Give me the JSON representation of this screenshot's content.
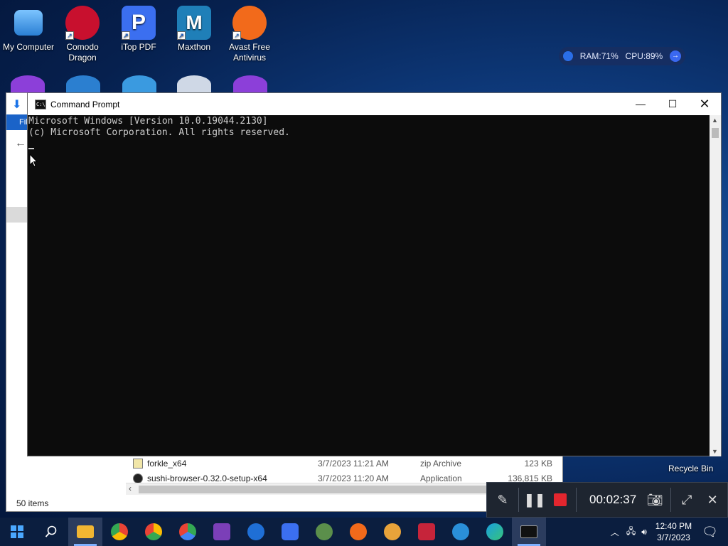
{
  "desktop": {
    "icons": [
      {
        "label": "My Computer",
        "color": "#2a7fd4"
      },
      {
        "label": "Comodo Dragon",
        "color": "#c8102e"
      },
      {
        "label": "iTop PDF",
        "color": "#3b6ff0"
      },
      {
        "label": "Maxthon",
        "color": "#1f7fb8"
      },
      {
        "label": "Avast Free Antivirus",
        "color": "#f26a1b"
      }
    ],
    "recycle_bin": "Recycle Bin"
  },
  "perf_widget": {
    "ram": "RAM:71%",
    "cpu": "CPU:89%"
  },
  "explorer": {
    "ribbon_tab": "Fil",
    "files": [
      {
        "name": "forkle_x64",
        "date": "3/7/2023 11:21 AM",
        "type": "zip Archive",
        "size": "123 KB"
      },
      {
        "name": "sushi-browser-0.32.0-setup-x64",
        "date": "3/7/2023 11:20 AM",
        "type": "Application",
        "size": "136,815 KB"
      }
    ],
    "status": "50 items"
  },
  "cmd": {
    "title": "Command Prompt",
    "lines": [
      "Microsoft Windows [Version 10.0.19044.2130]",
      "(c) Microsoft Corporation. All rights reserved."
    ]
  },
  "recorder": {
    "elapsed": "00:02:37"
  },
  "taskbar": {
    "apps": [
      {
        "name": "search",
        "color": "transparent"
      },
      {
        "name": "file-explorer",
        "color": "#f2b632"
      },
      {
        "name": "chrome-1",
        "color": "#34a853"
      },
      {
        "name": "chrome-2",
        "color": "#fbbc05"
      },
      {
        "name": "chrome-3",
        "color": "#ea4335"
      },
      {
        "name": "visual-studio",
        "color": "#7b3fb8"
      },
      {
        "name": "ccleaner",
        "color": "#1f6fd6"
      },
      {
        "name": "itop-pdf",
        "color": "#3b6ff0"
      },
      {
        "name": "globe",
        "color": "#5b8f4b"
      },
      {
        "name": "avast",
        "color": "#f26a1b"
      },
      {
        "name": "brave",
        "color": "#e8a33a"
      },
      {
        "name": "recorder",
        "color": "#c6243a"
      },
      {
        "name": "settings-globe",
        "color": "#2a8fd8"
      },
      {
        "name": "edge",
        "color": "#1aa0e0"
      },
      {
        "name": "command-prompt",
        "color": "#111111"
      }
    ],
    "time": "12:40 PM",
    "date": "3/7/2023"
  }
}
